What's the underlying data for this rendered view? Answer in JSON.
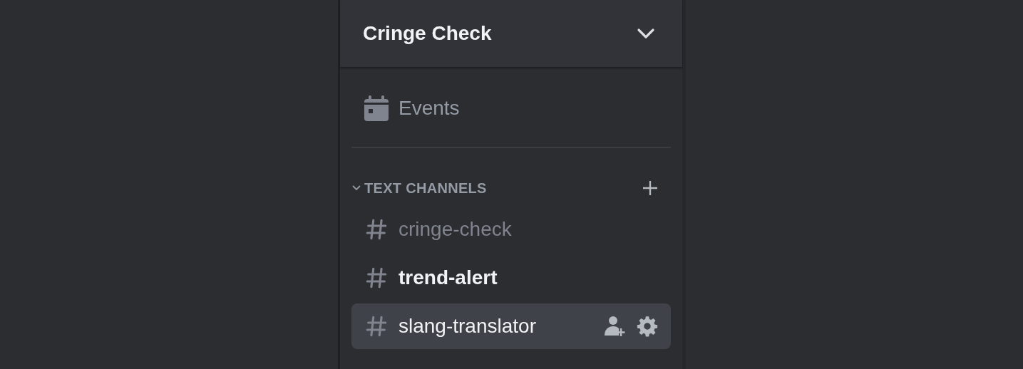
{
  "server": {
    "name": "Cringe Check",
    "menu_open": false
  },
  "events": {
    "label": "Events"
  },
  "categories": [
    {
      "name": "TEXT CHANNELS",
      "expanded": true,
      "channels": [
        {
          "name": "cringe-check",
          "unread": false,
          "selected": false
        },
        {
          "name": "trend-alert",
          "unread": true,
          "selected": false
        },
        {
          "name": "slang-translator",
          "unread": false,
          "selected": true
        }
      ]
    }
  ]
}
